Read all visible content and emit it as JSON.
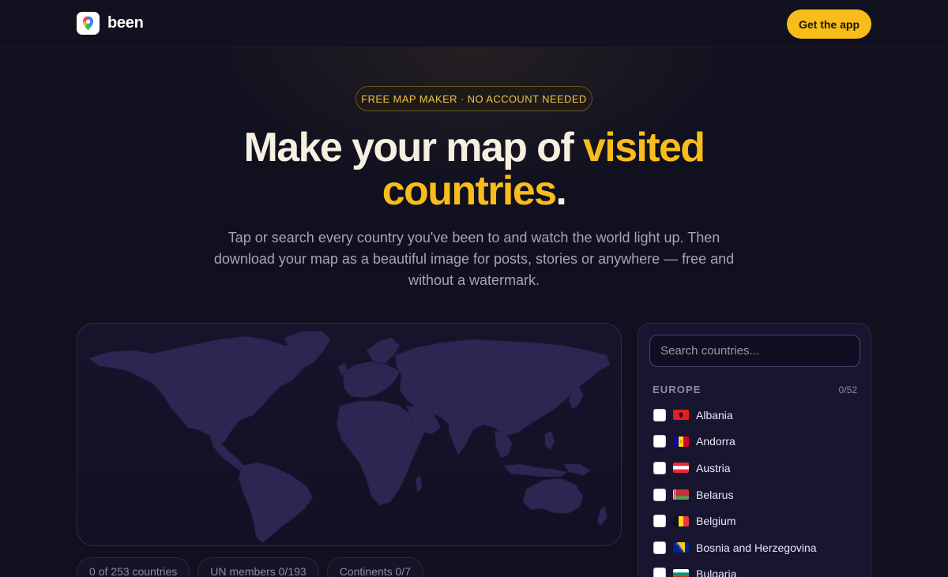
{
  "header": {
    "brand_name": "been",
    "cta_label": "Get the app"
  },
  "hero": {
    "badge": "FREE MAP MAKER · NO ACCOUNT NEEDED",
    "title_part1": "Make your map of ",
    "title_highlight": "visited countries",
    "title_end": ".",
    "subtitle": "Tap or search every country you've been to and watch the world light up. Then download your map as a beautiful image for posts, stories or anywhere — free and without a watermark."
  },
  "map": {
    "land_color": "#2b2652",
    "background_color": "#13112a"
  },
  "stats": [
    {
      "label": "0 of 253 countries"
    },
    {
      "label": "UN members 0/193"
    },
    {
      "label": "Continents 0/7"
    }
  ],
  "panel": {
    "search_placeholder": "Search countries...",
    "region": {
      "name": "EUROPE",
      "count": "0/52"
    },
    "countries": [
      {
        "name": "Albania",
        "checked": false,
        "flag": "albania-flag-icon"
      },
      {
        "name": "Andorra",
        "checked": false,
        "flag": "andorra-flag-icon"
      },
      {
        "name": "Austria",
        "checked": false,
        "flag": "austria-flag-icon"
      },
      {
        "name": "Belarus",
        "checked": false,
        "flag": "belarus-flag-icon"
      },
      {
        "name": "Belgium",
        "checked": false,
        "flag": "belgium-flag-icon"
      },
      {
        "name": "Bosnia and Herzegovina",
        "checked": false,
        "flag": "bosnia-flag-icon"
      },
      {
        "name": "Bulgaria",
        "checked": false,
        "flag": "bulgaria-flag-icon"
      }
    ]
  },
  "colors": {
    "accent": "#f8bd1a",
    "background": "#11101f"
  }
}
